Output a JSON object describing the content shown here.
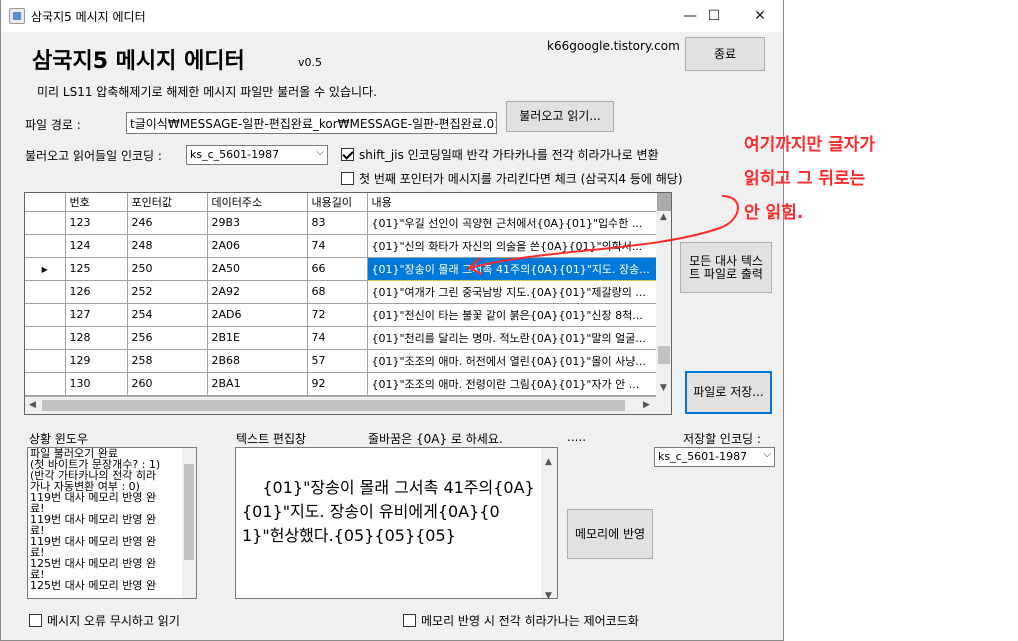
{
  "window": {
    "title": "삼국지5 메시지 에디터",
    "controls": {
      "minimize": "—",
      "maximize": "☐",
      "close": "✕"
    }
  },
  "header": {
    "app_title": "삼국지5 메시지 에디터",
    "version": "v0.5",
    "website": "k66google.tistory.com",
    "exit_label": "종료",
    "note": "미리 LS11 압축해제기로 해제한 메시지 파일만 불러올 수 있습니다."
  },
  "file": {
    "path_label": "파일 경로 :",
    "path_value": "t글이식₩MESSAGE-일판-편집완료_kor₩MESSAGE-일판-편집완료.018",
    "load_button": "불러오고 읽기..."
  },
  "encoding": {
    "label": "불러오고 읽어들일 인코딩 :",
    "value": "ks_c_5601-1987",
    "shift_jis_label": "shift_jis 인코딩일때 반각 가타카나를 전각 히라가나로 변환",
    "shift_jis_checked": true,
    "first_pointer_label": "첫 번째 포인터가 메시지를 가리킨다면 체크 (삼국지4 등에 해당)",
    "first_pointer_checked": false
  },
  "grid": {
    "columns": [
      "번호",
      "포인터값",
      "데이터주소",
      "내용길이",
      "내용"
    ],
    "selected_index": 2,
    "rows": [
      {
        "no": "123",
        "ptr": "246",
        "addr": "29B3",
        "len": "83",
        "content": "{01}\"우길 선인이 곡양현 근처에서{0A}{01}\"입수한 ..."
      },
      {
        "no": "124",
        "ptr": "248",
        "addr": "2A06",
        "len": "74",
        "content": "{01}\"신의 화타가 자신의 의술을 쓴{0A}{01}\"의학서..."
      },
      {
        "no": "125",
        "ptr": "250",
        "addr": "2A50",
        "len": "66",
        "content": "{01}\"장송이 몰래 그서촉 41주의{0A}{01}\"지도. 장송..."
      },
      {
        "no": "126",
        "ptr": "252",
        "addr": "2A92",
        "len": "68",
        "content": "{01}\"여개가 그린 중국남방 지도.{0A}{01}\"제갈량의 ..."
      },
      {
        "no": "127",
        "ptr": "254",
        "addr": "2AD6",
        "len": "72",
        "content": "{01}\"전신이 타는 불꽃 같이 붉은{0A}{01}\"신장 8척..."
      },
      {
        "no": "128",
        "ptr": "256",
        "addr": "2B1E",
        "len": "74",
        "content": "{01}\"천리를 달리는 명마. 적노란{0A}{01}\"말의 얼굴..."
      },
      {
        "no": "129",
        "ptr": "258",
        "addr": "2B68",
        "len": "57",
        "content": "{01}\"조조의 애마. 허전에서 열린{0A}{01}\"몰이 사냥..."
      },
      {
        "no": "130",
        "ptr": "260",
        "addr": "2BA1",
        "len": "92",
        "content": "{01}\"조조의 애마. 전령이란 그림{0A}{01}\"자가 안 ..."
      }
    ]
  },
  "side_buttons": {
    "export_all": "모든 대사 텍스트 파일로 출력",
    "save_file": "파일로 저장..."
  },
  "status": {
    "label": "상황 윈도우",
    "lines": [
      "파일 불러오기 완료",
      "(첫 바이트가 문장개수? : 1)",
      "(반각 가타카나의 전각 히라",
      "가나 자동변환 여부 : 0)",
      "119번 대사 메모리 반영 완",
      "료!",
      "119번 대사 메모리 반영 완",
      "료!",
      "119번 대사 메모리 반영 완",
      "료!",
      "125번 대사 메모리 반영 완",
      "료!",
      "125번 대사 메모리 반영 완"
    ]
  },
  "editor": {
    "label": "텍스트 편집창",
    "hint": "줄바꿈은 {0A} 로 하세요.",
    "dots": ".....",
    "text": "{01}\"장송이 몰래 그서촉 41주의{0A}{01}\"지도. 장송이 유비에게{0A}{01}\"헌상했다.{05}{05}{05}",
    "apply_button": "메모리에 반영"
  },
  "save_encoding": {
    "label": "저장할 인코딩 :",
    "value": "ks_c_5601-1987"
  },
  "bottom": {
    "ignore_errors_label": "메시지 오류 무시하고 읽기",
    "ignore_errors_checked": false,
    "control_code_label": "메모리 반영 시 전각 히라가나는 제어코드화",
    "control_code_checked": false
  },
  "annotation": {
    "lines": [
      "여기까지만 글자가",
      "읽히고 그 뒤로는",
      "안 읽힘."
    ],
    "color": "#ff2a2a"
  }
}
